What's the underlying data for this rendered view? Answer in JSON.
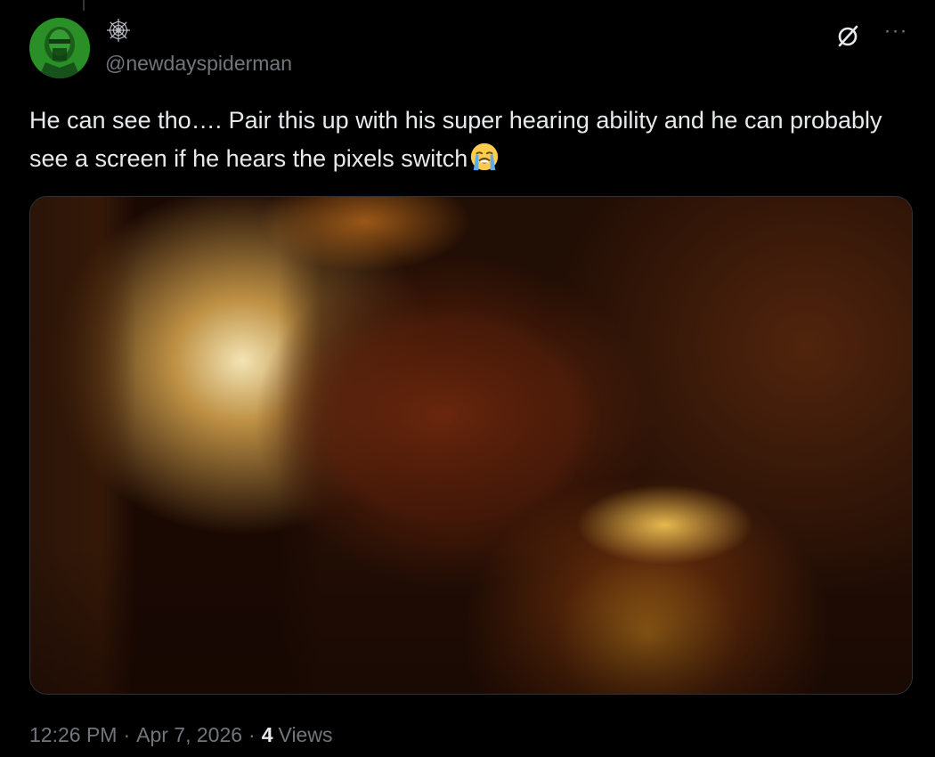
{
  "author": {
    "display_name_icon": "spider-web-icon",
    "handle": "@newdayspiderman"
  },
  "tweet": {
    "text": "He can see tho…. Pair this up with his super hearing ability and he can probably see a screen if he hears the pixels switch",
    "emoji": "loudly-crying-face-emoji"
  },
  "media": {
    "type": "image",
    "description_icon": "photo-image"
  },
  "meta": {
    "time": "12:26 PM",
    "separator": "·",
    "date": "Apr 7, 2026",
    "views_count": "4",
    "views_label": "Views"
  },
  "actions": {
    "grok_icon": "grok-icon",
    "more_icon": "more-options-icon",
    "more_label": "···"
  },
  "colors": {
    "background": "#000000",
    "text_primary": "#e7e9ea",
    "text_secondary": "#71767b",
    "border": "#2f3336",
    "avatar_green": "#2e9a2a"
  }
}
